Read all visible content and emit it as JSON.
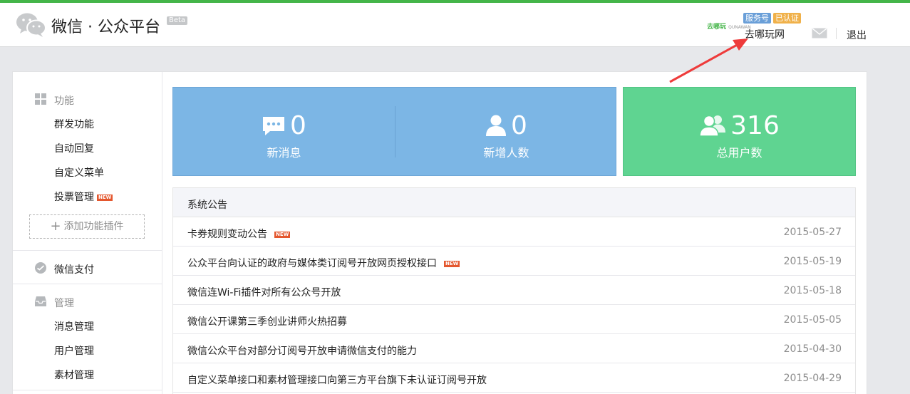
{
  "header": {
    "brand": "微信 · 公众平台",
    "beta": "Beta",
    "account_logo_main": "去哪玩",
    "account_logo_sub": "QUNAWAN",
    "tag_service": "服务号",
    "tag_verified": "已认证",
    "account_name": "去哪玩网",
    "logout": "退出"
  },
  "sidebar": {
    "section_function": "功能",
    "function_items": [
      "群发功能",
      "自动回复",
      "自定义菜单",
      "投票管理"
    ],
    "new_badge": "NEW",
    "add_plugin": "添加功能插件",
    "section_pay": "微信支付",
    "section_manage": "管理",
    "manage_items": [
      "消息管理",
      "用户管理",
      "素材管理"
    ]
  },
  "stats": {
    "new_messages": {
      "value": "0",
      "label": "新消息"
    },
    "new_users": {
      "value": "0",
      "label": "新增人数"
    },
    "total_users": {
      "value": "316",
      "label": "总用户数"
    }
  },
  "notice": {
    "title": "系统公告",
    "items": [
      {
        "title": "卡券规则变动公告",
        "date": "2015-05-27",
        "new": true
      },
      {
        "title": "公众平台向认证的政府与媒体类订阅号开放网页授权接口",
        "date": "2015-05-19",
        "new": true
      },
      {
        "title": "微信连Wi-Fi插件对所有公众号开放",
        "date": "2015-05-18",
        "new": false
      },
      {
        "title": "微信公开课第三季创业讲师火热招募",
        "date": "2015-05-05",
        "new": false
      },
      {
        "title": "微信公众平台对部分订阅号开放申请微信支付的能力",
        "date": "2015-04-30",
        "new": false
      },
      {
        "title": "自定义菜单接口和素材管理接口向第三方平台旗下未认证订阅号开放",
        "date": "2015-04-29",
        "new": false
      }
    ]
  },
  "colors": {
    "accent_green": "#44b549",
    "stat_blue": "#7cb6e5",
    "stat_green": "#5fd491",
    "new_badge": "#e4572e",
    "annotation_arrow": "#ee3b3b"
  }
}
